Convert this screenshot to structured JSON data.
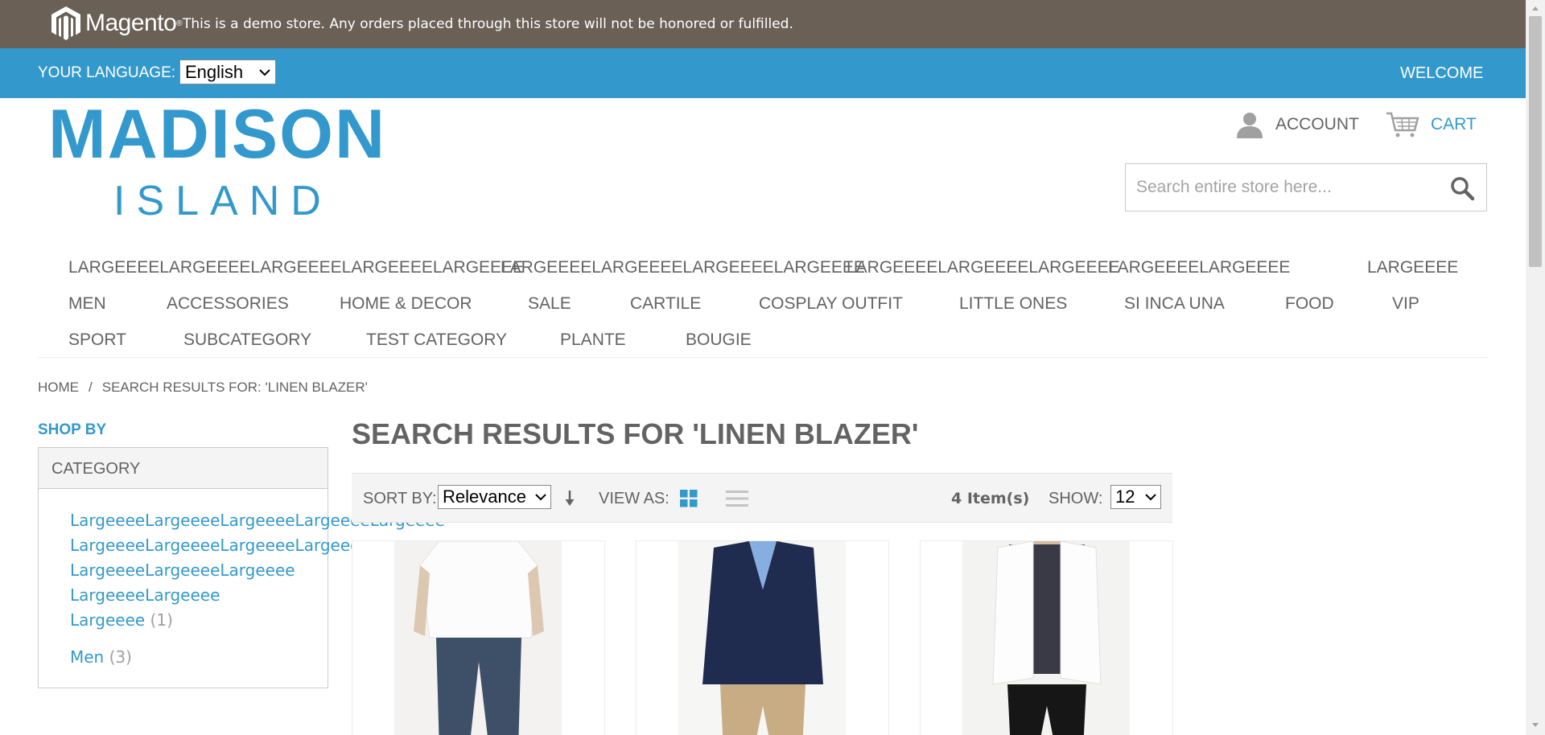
{
  "demo_notice": {
    "brand": "Magento",
    "text": "This is a demo store. Any orders placed through this store will not be honored or fulfilled."
  },
  "language_bar": {
    "label": "YOUR LANGUAGE:",
    "selected": "English",
    "welcome": "WELCOME"
  },
  "logo": {
    "line1": "MADISON",
    "line2": "ISLAND"
  },
  "header": {
    "account_label": "ACCOUNT",
    "cart_label": "CART",
    "search_placeholder": "Search entire store here..."
  },
  "nav": {
    "items": [
      "LARGEEEELARGEEEELARGEEEELARGEEEELARGEEEE",
      "LARGEEEELARGEEEELARGEEEELARGEEEE",
      "LARGEEEELARGEEEELARGEEEE",
      "LARGEEEELARGEEEE",
      "LARGEEEE",
      "MEN",
      "ACCESSORIES",
      "HOME & DECOR",
      "SALE",
      "CARTILE",
      "COSPLAY OUTFIT",
      "LITTLE ONES",
      "SI INCA UNA",
      "FOOD",
      "VIP",
      "SPORT",
      "SUBCATEGORY",
      "TEST CATEGORY",
      "PLANTE",
      "BOUGIE"
    ]
  },
  "breadcrumb": {
    "home": "HOME",
    "separator": "/",
    "current": "SEARCH RESULTS FOR: 'LINEN BLAZER'"
  },
  "sidebar": {
    "title": "SHOP BY",
    "section": "CATEGORY",
    "links": [
      {
        "label": "LargeeeeLargeeeeLargeeeeLargeeeeLargeeee",
        "count": ""
      },
      {
        "label": "LargeeeeLargeeeeLargeeeeLargeeee",
        "count": ""
      },
      {
        "label": "LargeeeeLargeeeeLargeeee",
        "count": ""
      },
      {
        "label": "LargeeeeLargeeee",
        "count": ""
      },
      {
        "label": "Largeeee",
        "count": "(1)"
      },
      {
        "label": "Men",
        "count": "(3)"
      }
    ]
  },
  "main": {
    "title": "SEARCH RESULTS FOR 'LINEN BLAZER'",
    "toolbar": {
      "sort_label": "SORT BY:",
      "sort_value": "Relevance",
      "view_label": "VIEW AS:",
      "items_count": "4 Item(s)",
      "show_label": "SHOW:",
      "show_value": "12"
    }
  },
  "colors": {
    "brand_blue": "#3399cc",
    "demo_bar": "#6a6055",
    "text": "#636363"
  }
}
